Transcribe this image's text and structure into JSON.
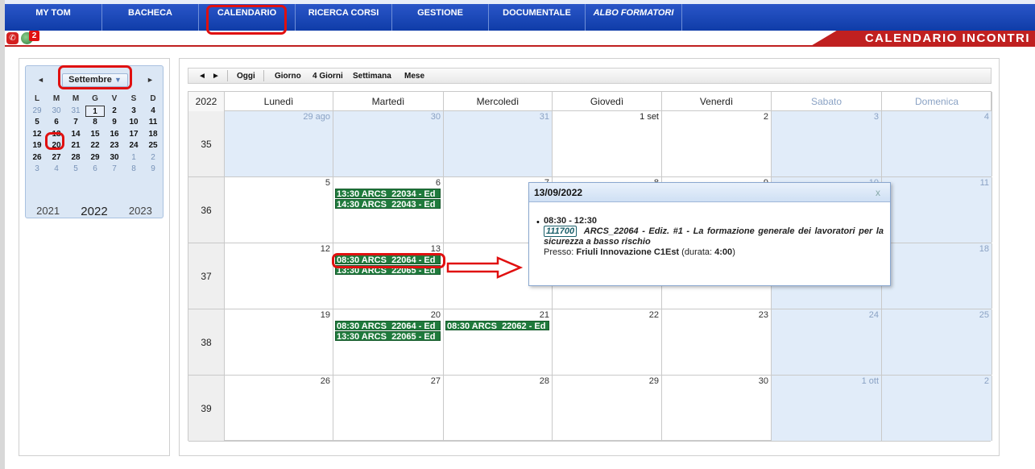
{
  "nav": {
    "items": [
      "MY TOM",
      "BACHECA",
      "CALENDARIO",
      "RICERCA CORSI",
      "GESTIONE",
      "DOCUMENTALE",
      "ALBO FORMATORI"
    ]
  },
  "header": {
    "notification_count": "2",
    "banner": "CALENDARIO INCONTRI"
  },
  "mini_calendar": {
    "month": "Settembre",
    "day_headers": [
      "L",
      "M",
      "M",
      "G",
      "V",
      "S",
      "D"
    ],
    "weeks": [
      [
        "29",
        "30",
        "31",
        "1",
        "2",
        "3",
        "4"
      ],
      [
        "5",
        "6",
        "7",
        "8",
        "9",
        "10",
        "11"
      ],
      [
        "12",
        "13",
        "14",
        "15",
        "16",
        "17",
        "18"
      ],
      [
        "19",
        "20",
        "21",
        "22",
        "23",
        "24",
        "25"
      ],
      [
        "26",
        "27",
        "28",
        "29",
        "30",
        "1",
        "2"
      ],
      [
        "3",
        "4",
        "5",
        "6",
        "7",
        "8",
        "9"
      ]
    ],
    "years": [
      "2021",
      "2022",
      "2023"
    ]
  },
  "toolbar": {
    "prev": "◄",
    "next": "►",
    "today": "Oggi",
    "day": "Giorno",
    "four_days": "4 Giorni",
    "week": "Settimana",
    "month": "Mese"
  },
  "calendar": {
    "year": "2022",
    "weekdays": [
      "Lunedì",
      "Martedì",
      "Mercoledì",
      "Giovedì",
      "Venerdì",
      "Sabato",
      "Domenica"
    ],
    "weeks": [
      {
        "no": "35",
        "days": [
          "29 ago",
          "30",
          "31",
          "1 set",
          "2",
          "3",
          "4"
        ]
      },
      {
        "no": "36",
        "days": [
          "5",
          "6",
          "7",
          "8",
          "9",
          "10",
          "11"
        ]
      },
      {
        "no": "37",
        "days": [
          "12",
          "13",
          "",
          "",
          "",
          "",
          "18"
        ]
      },
      {
        "no": "38",
        "days": [
          "19",
          "20",
          "21",
          "22",
          "23",
          "24",
          "25"
        ]
      },
      {
        "no": "39",
        "days": [
          "26",
          "27",
          "28",
          "29",
          "30",
          "1 ott",
          "2"
        ]
      }
    ],
    "events": {
      "w36_tue_1": "13:30 ARCS_22034 - Ed",
      "w36_tue_2": "14:30 ARCS_22043 - Ed",
      "w37_tue_1": "08:30 ARCS_22064 - Ed",
      "w37_tue_2": "13:30 ARCS_22065 - Ed",
      "w38_tue_1": "08:30 ARCS_22064 - Ed",
      "w38_tue_2": "13:30 ARCS_22065 - Ed",
      "w38_wed_1": "08:30 ARCS_22062 - Ed"
    }
  },
  "popup": {
    "date": "13/09/2022",
    "close": "x",
    "time": "08:30 - 12:30",
    "code": "111700",
    "title": "ARCS_22064 - Ediz. #1 - La formazione generale dei lavoratori per la sicurezza a basso rischio",
    "location_label": "Presso:",
    "location": "Friuli Innovazione C1Est",
    "duration_label": "(durata:",
    "duration": "4:00",
    "duration_close": ")"
  }
}
